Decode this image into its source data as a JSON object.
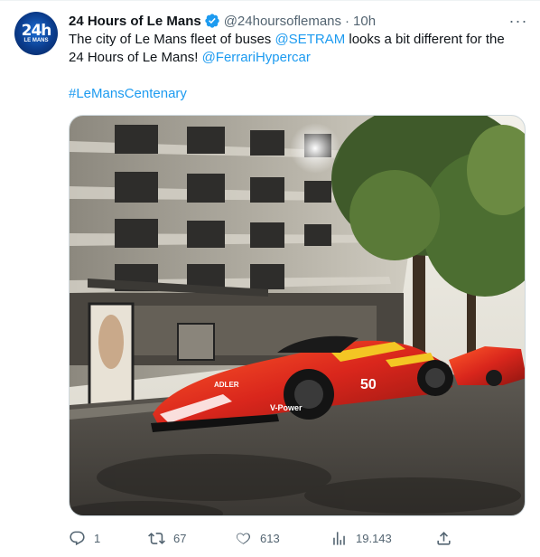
{
  "tweet": {
    "display_name": "24 Hours of Le Mans",
    "handle": "@24hoursoflemans",
    "separator": "·",
    "time": "10h",
    "avatar_text": "24h",
    "avatar_subtext": "LE MANS",
    "text_part1": "The city of Le Mans fleet of buses ",
    "mention1": "@SETRAM",
    "text_part2": " looks a bit different for the 24 Hours of Le Mans! ",
    "mention2": "@FerrariHypercar",
    "hashtag": "#LeMansCentenary",
    "more_label": "···"
  },
  "media": {
    "car_number": "50",
    "sponsor_text": "V-Power",
    "sponsor2_text": "ADLER"
  },
  "actions": {
    "replies": "1",
    "retweets": "67",
    "likes": "613",
    "views": "19.143"
  },
  "icons": {
    "verified": "verified-badge-icon",
    "reply": "reply-icon",
    "retweet": "retweet-icon",
    "like": "heart-icon",
    "views": "views-chart-icon",
    "share": "share-icon"
  },
  "colors": {
    "link": "#1d9bf0",
    "secondary": "#536471",
    "verified": "#1d9bf0",
    "ferrari_red": "#d9261c"
  }
}
